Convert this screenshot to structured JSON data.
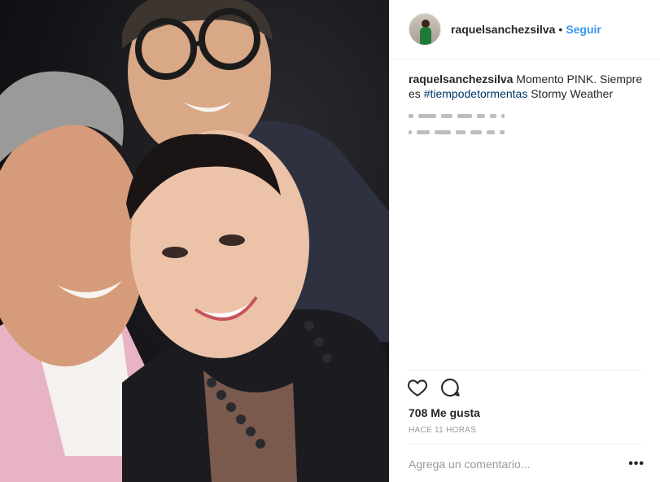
{
  "post": {
    "username": "raquelsanchezsilva",
    "separator": "•",
    "follow_label": "Seguir",
    "caption": {
      "text_before": "Momento PINK. Siempre es ",
      "hashtag": "#tiempodetormentas",
      "text_after": " Stormy Weather"
    },
    "likes": "708 Me gusta",
    "time": "HACE 11 HORAS",
    "comment_placeholder": "Agrega un comentario...",
    "more_label": "•••"
  },
  "icons": {
    "like": "heart-outline-icon",
    "comment": "speech-bubble-icon",
    "more": "ellipsis-icon"
  },
  "colors": {
    "link_blue": "#3897f0",
    "hashtag_blue": "#003569",
    "muted_gray": "#999999",
    "text": "#262626"
  }
}
